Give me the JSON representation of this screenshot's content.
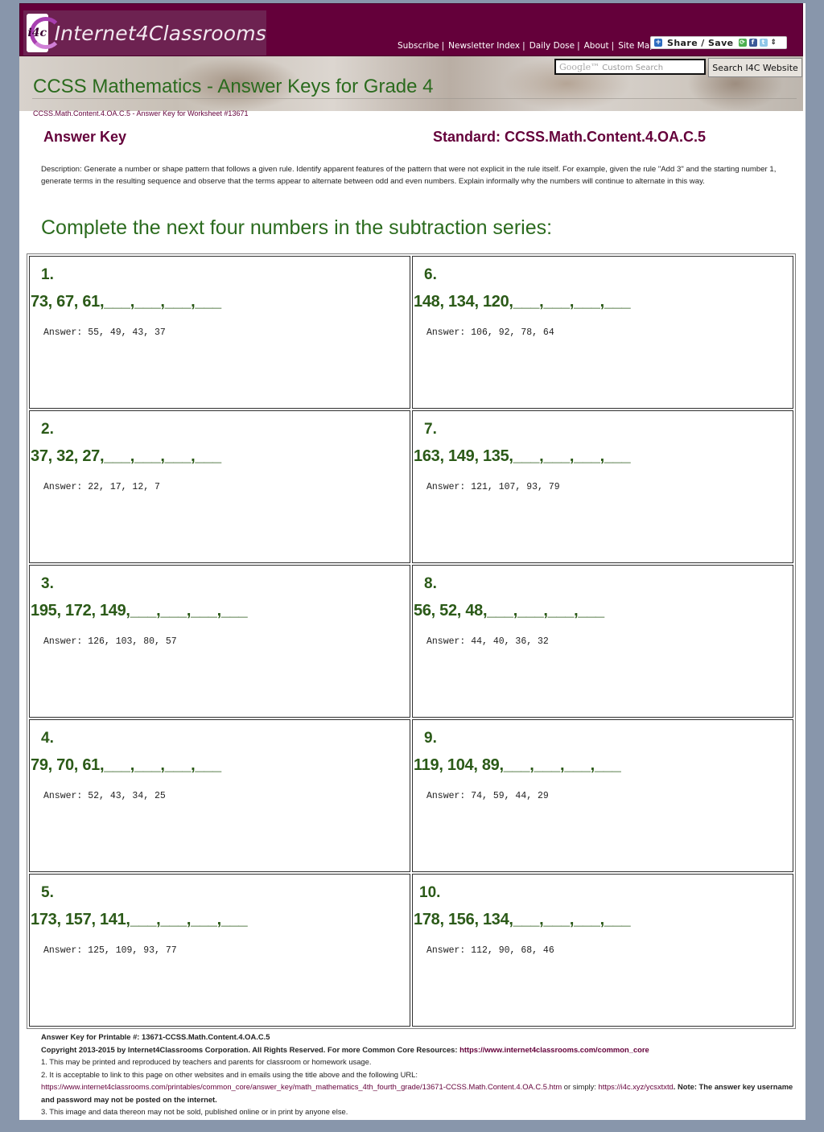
{
  "header": {
    "logo_badge": "i4c",
    "logo_text": "Internet4Classrooms",
    "nav": [
      "Subscribe",
      "Newsletter Index",
      "Daily Dose",
      "About",
      "Site Map"
    ],
    "share_label": "Share / Save",
    "search_placeholder_brand": "Google™",
    "search_placeholder": "Custom Search",
    "search_button": "Search I4C Website",
    "page_title": "CCSS Mathematics - Answer Keys for Grade 4",
    "breadcrumb": "CCSS.Math.Content.4.OA.C.5 - Answer Key for Worksheet #13671"
  },
  "main": {
    "answer_key_label": "Answer Key",
    "standard_label": "Standard: CCSS.Math.Content.4.OA.C.5",
    "description": "Description: Generate a number or shape pattern that follows a given rule. Identify apparent features of the pattern that were not explicit in the rule itself. For example, given the rule \"Add 3\" and the starting number 1, generate terms in the resulting sequence and observe that the terms appear to alternate between odd and even numbers. Explain informally why the numbers will continue to alternate in this way.",
    "instruction": "Complete the next four numbers in the subtraction series:",
    "problems": [
      {
        "number": "1.",
        "series": "73, 67, 61,___,___,___,___",
        "answer": "Answer: 55, 49, 43, 37"
      },
      {
        "number": "6.",
        "series": "148, 134, 120,___,___,___,___",
        "answer": "Answer: 106, 92, 78, 64"
      },
      {
        "number": "2.",
        "series": "37, 32, 27,___,___,___,___",
        "answer": "Answer: 22, 17, 12, 7"
      },
      {
        "number": "7.",
        "series": "163, 149, 135,___,___,___,___",
        "answer": "Answer: 121, 107, 93, 79"
      },
      {
        "number": "3.",
        "series": "195, 172, 149,___,___,___,___",
        "answer": "Answer: 126, 103, 80, 57"
      },
      {
        "number": "8.",
        "series": "56, 52, 48,___,___,___,___",
        "answer": "Answer: 44, 40, 36, 32"
      },
      {
        "number": "4.",
        "series": "79, 70, 61,___,___,___,___",
        "answer": "Answer: 52, 43, 34, 25"
      },
      {
        "number": "9.",
        "series": "119, 104, 89,___,___,___,___",
        "answer": "Answer: 74, 59, 44, 29"
      },
      {
        "number": "5.",
        "series": "173, 157, 141,___,___,___,___",
        "answer": "Answer: 125, 109, 93, 77"
      },
      {
        "number": "10.",
        "series": "178, 156, 134,___,___,___,___",
        "answer": "Answer: 112, 90, 68, 46"
      }
    ]
  },
  "footer": {
    "printable": "Answer Key for Printable #: 13671-CCSS.Math.Content.4.OA.C.5",
    "copyright": "Copyright 2013-2015 by Internet4Classrooms Corporation. All Rights Reserved. For more Common Core Resources: ",
    "common_core_link": "https://www.internet4classrooms.com/common_core",
    "note1": "1. This may be printed and reproduced by teachers and parents for classroom or homework usage.",
    "note2": "2. It is acceptable to link to this page on other websites and in emails using the title above and the following URL:",
    "long_url": "https://www.internet4classrooms.com/printables/common_core/answer_key/math_mathematics_4th_fourth_grade/13671-CCSS.Math.Content.4.OA.C.5.htm",
    "or_simply": " or simply: ",
    "short_url": "https://i4c.xyz/ycsxtxtd",
    "note_bold": ". Note: The answer key username and password may not be posted on the internet.",
    "note3": "3. This image and data thereon may not be sold, published online or in print by anyone else."
  }
}
